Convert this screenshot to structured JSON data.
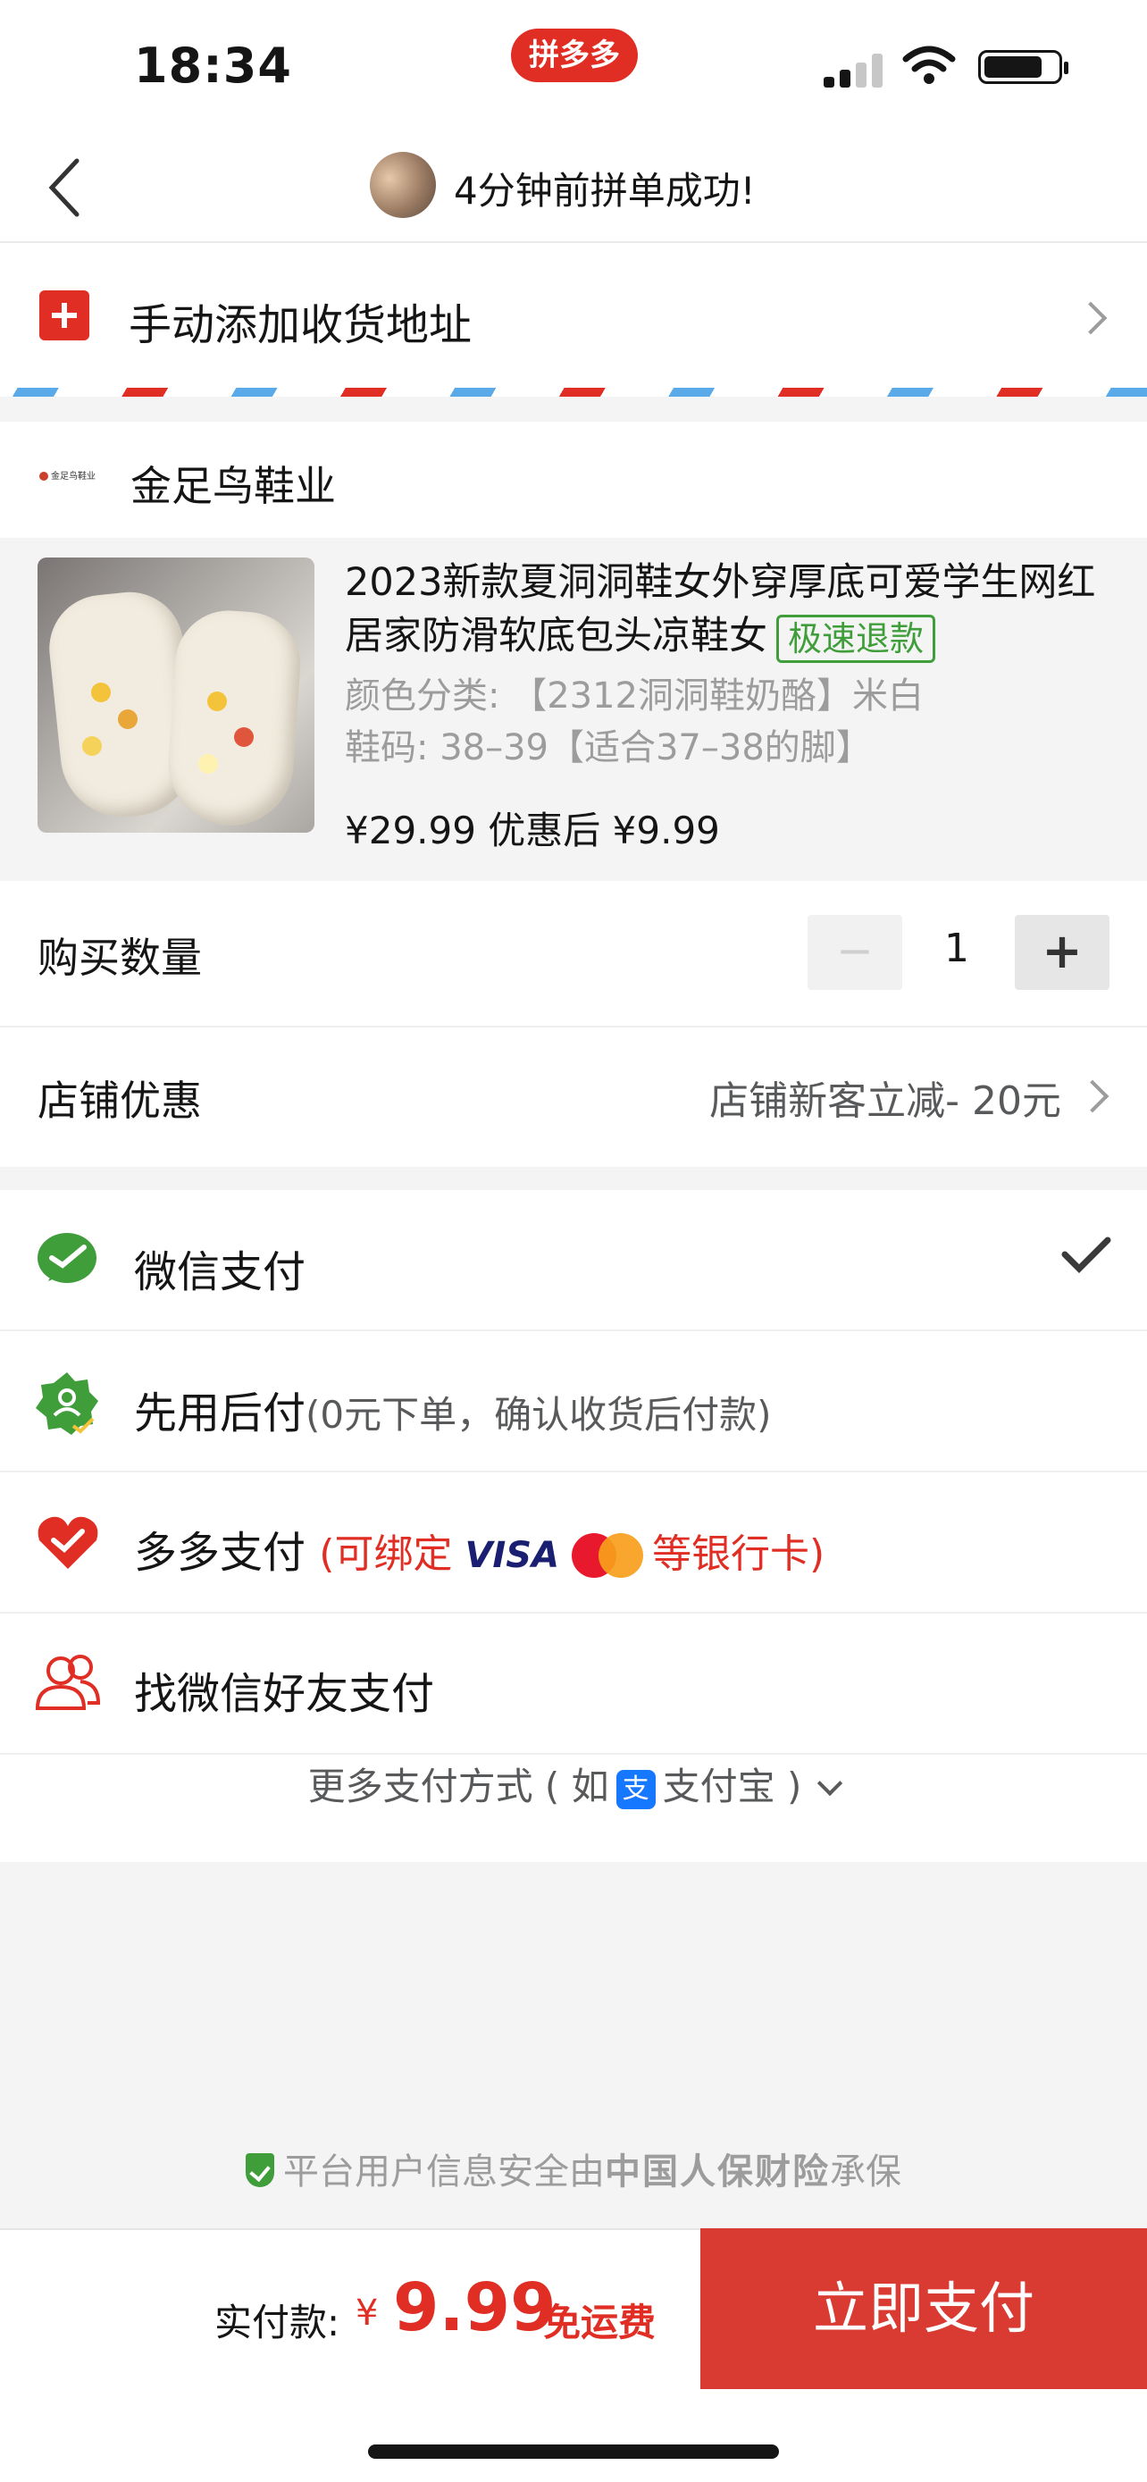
{
  "status": {
    "time": "18:34",
    "app_badge": "拼多多"
  },
  "nav": {
    "title": "4分钟前拼单成功!"
  },
  "address": {
    "label": "手动添加收货地址"
  },
  "shop": {
    "name": "金足鸟鞋业",
    "logo_text": "金足鸟鞋业"
  },
  "product": {
    "title": "2023新款夏洞洞鞋女外穿厚底可爱学生网红居家防滑软底包头凉鞋女",
    "tag": "极速退款",
    "spec_color": "颜色分类: 【2312洞洞鞋奶酪】米白",
    "spec_size": "鞋码: 38–39【适合37–38的脚】",
    "price": "¥29.99 优惠后 ¥9.99"
  },
  "quantity": {
    "label": "购买数量",
    "minus": "−",
    "value": "1",
    "plus": "+"
  },
  "coupon": {
    "label": "店铺优惠",
    "value": "店铺新客立减- 20元"
  },
  "payments": {
    "wechat": {
      "label": "微信支付",
      "selected": true
    },
    "later": {
      "label": "先用后付",
      "sub": "(0元下单，确认收货后付款)"
    },
    "duoduo": {
      "label": "多多支付",
      "prefix": "(可绑定",
      "visa": "VISA",
      "suffix": "等银行卡)"
    },
    "friend": {
      "label": "找微信好友支付"
    },
    "more": {
      "prefix": "更多支付方式 ( 如",
      "alipay_glyph": "支",
      "alipay": "支付宝",
      "suffix": ")"
    }
  },
  "security": {
    "prefix": "平台用户信息安全由",
    "brand": "中国人保财险",
    "suffix": "承保"
  },
  "footer": {
    "total_label": "实付款:",
    "currency": "¥",
    "total": "9.99",
    "shipping": "免运费",
    "pay_button": "立即支付"
  },
  "colors": {
    "brand_red": "#e02e24",
    "wechat_green": "#3f9e3a",
    "alipay_blue": "#1677ff"
  }
}
